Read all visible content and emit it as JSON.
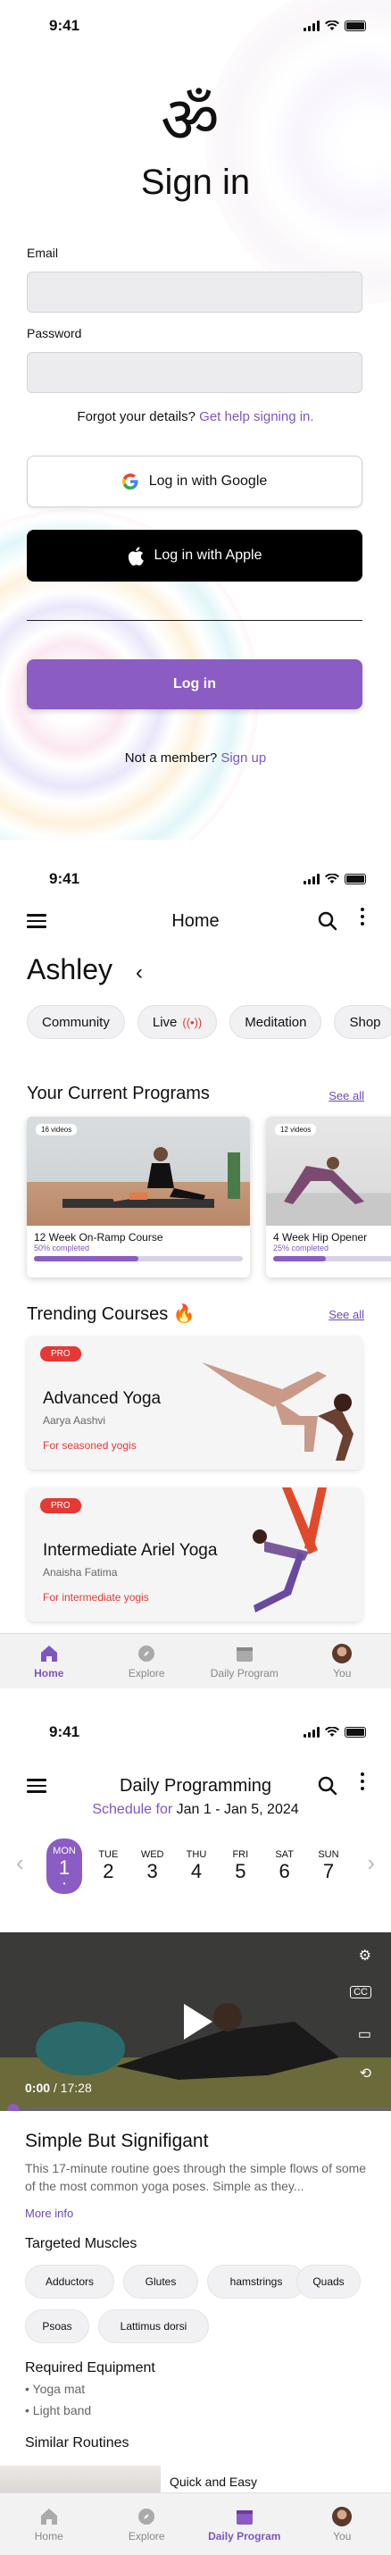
{
  "status": {
    "time": "9:41"
  },
  "signin": {
    "title": "Sign in",
    "om_symbol": "ॐ",
    "email_label": "Email",
    "password_label": "Password",
    "forgot_text": "Forgot your details?",
    "forgot_link": "Get help signing in.",
    "google_label": "Log in with Google",
    "apple_label": "Log in with Apple",
    "login_label": "Log in",
    "member_text": "Not a member?",
    "signup_link": "Sign up",
    "accent": "#8a5cc4"
  },
  "home": {
    "title": "Home",
    "user": "Ashley",
    "chips": [
      "Community",
      "Live",
      "Meditation",
      "Shop"
    ],
    "programs_title": "Your Current  Programs",
    "see_all": "See all",
    "programs": [
      {
        "badge": "16 videos",
        "name": "12 Week On-Ramp Course",
        "sub": "50% completed",
        "progress": 0.5
      },
      {
        "badge": "12 videos",
        "name": "4 Week Hip Opener",
        "sub": "25% completed",
        "progress": 0.25
      }
    ],
    "trending_title": "Trending Courses 🔥",
    "courses": [
      {
        "badge": "PRO",
        "title": "Advanced Yoga",
        "by": "Aarya Aashvi",
        "for": "For seasoned yogis"
      },
      {
        "badge": "PRO",
        "title": "Intermediate Ariel Yoga",
        "by": "Anaisha Fatima",
        "for": "For intermediate yogis"
      }
    ]
  },
  "tabs": [
    "Home",
    "Explore",
    "Daily Program",
    "You"
  ],
  "daily": {
    "title": "Daily Programming",
    "schedule_label": "Schedule for",
    "schedule_range": "Jan 1 - Jan 5, 2024",
    "days": [
      {
        "d": "MON",
        "n": "1"
      },
      {
        "d": "TUE",
        "n": "2"
      },
      {
        "d": "WED",
        "n": "3"
      },
      {
        "d": "THU",
        "n": "4"
      },
      {
        "d": "FRI",
        "n": "5"
      },
      {
        "d": "SAT",
        "n": "6"
      },
      {
        "d": "SUN",
        "n": "7"
      }
    ],
    "video_current": "0:00",
    "video_total": " / 17:28",
    "routine_title": "Simple But Signifigant",
    "routine_desc": "This 17-minute routine goes through the simple flows of some of the most common yoga poses. Simple as they...",
    "more_info": "More info",
    "muscles_title": "Targeted Muscles",
    "muscles": [
      "Adductors",
      "Glutes",
      "hamstrings",
      "Quads",
      "Psoas",
      "Lattimus dorsi"
    ],
    "equipment_title": "Required Equipment",
    "equipment": [
      "• Yoga mat",
      "• Light band"
    ],
    "similar_title": "Similar Routines",
    "similar_item": "Quick and Easy"
  }
}
